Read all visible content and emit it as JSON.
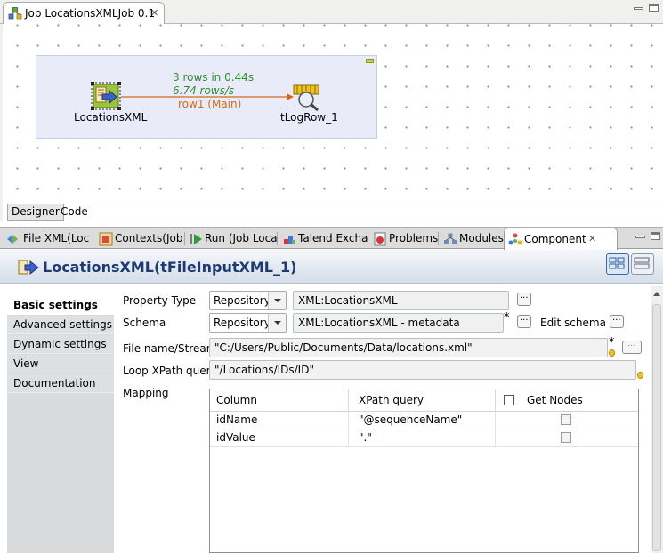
{
  "editor": {
    "tab_title": "Job LocationsXMLJob 0.1",
    "close_glyph": "✕",
    "nodes": {
      "input": {
        "label": "LocationsXML",
        "icon": "xml-input-icon"
      },
      "output": {
        "label": "tLogRow_1",
        "icon": "log-row-icon"
      }
    },
    "link": {
      "rows_text": "3 rows in 0.44s",
      "rate_text": "6.74 rows/s",
      "name": "row1 (Main)"
    },
    "bottom_tabs": [
      "Designer",
      "Code"
    ]
  },
  "view_tabs": [
    {
      "label": "File XML(Loc",
      "icon": "file-xml-icon"
    },
    {
      "label": "Contexts(Job",
      "icon": "contexts-icon"
    },
    {
      "label": "Run (Job Loca",
      "icon": "run-icon"
    },
    {
      "label": "Talend Excha",
      "icon": "exchange-icon"
    },
    {
      "label": "Problems",
      "icon": "problems-icon"
    },
    {
      "label": "Modules",
      "icon": "modules-icon"
    },
    {
      "label": "Component",
      "icon": "component-icon",
      "active": true
    }
  ],
  "component": {
    "title": "LocationsXML(tFileInputXML_1)"
  },
  "nav": {
    "items": [
      "Basic settings",
      "Advanced settings",
      "Dynamic settings",
      "View",
      "Documentation"
    ],
    "active": "Basic settings"
  },
  "form": {
    "property_type": {
      "label": "Property Type",
      "combo": "Repository",
      "value": "XML:LocationsXML",
      "btn": "..."
    },
    "schema": {
      "label": "Schema",
      "combo": "Repository",
      "value": "XML:LocationsXML - metadata",
      "btn": "...",
      "edit_label": "Edit schema"
    },
    "file_name": {
      "label": "File name/Stream",
      "value": "\"C:/Users/Public/Documents/Data/locations.xml\"",
      "btn": "..."
    },
    "loop_xpath": {
      "label": "Loop XPath query",
      "value": "\"/Locations/IDs/ID\""
    },
    "mapping": {
      "label": "Mapping",
      "headers": {
        "column": "Column",
        "xpath": "XPath query",
        "get_nodes": "Get Nodes"
      },
      "rows": [
        {
          "column": "idName",
          "xpath": "\"@sequenceName\"",
          "get_nodes": false
        },
        {
          "column": "idValue",
          "xpath": "\".\"",
          "get_nodes": false
        }
      ]
    }
  },
  "colors": {
    "link_stats": "#2f8f2f",
    "link_name": "#d06a1a",
    "component_title": "#1d3a75",
    "subjob_bg": "#e9ebf8"
  }
}
